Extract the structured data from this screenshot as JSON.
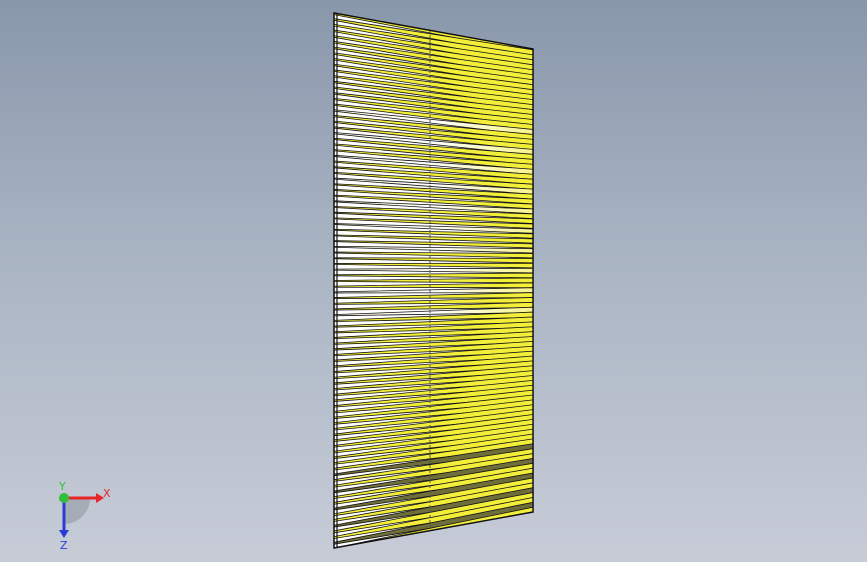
{
  "window": {
    "background_top": "#8997ab",
    "background_bottom": "#c7ccd7"
  },
  "model": {
    "type": "louvered-panel",
    "slat_color": "#f2ee3a",
    "slat_highlight": "#ffffff",
    "slat_shadow": "#6f6d3a",
    "edge_color": "#111111"
  },
  "triad": {
    "x_label": "X",
    "y_label": "Y",
    "z_label": "Z",
    "x_color": "#e8262a",
    "y_color": "#2fbf3a",
    "z_color": "#2a3bdc"
  }
}
